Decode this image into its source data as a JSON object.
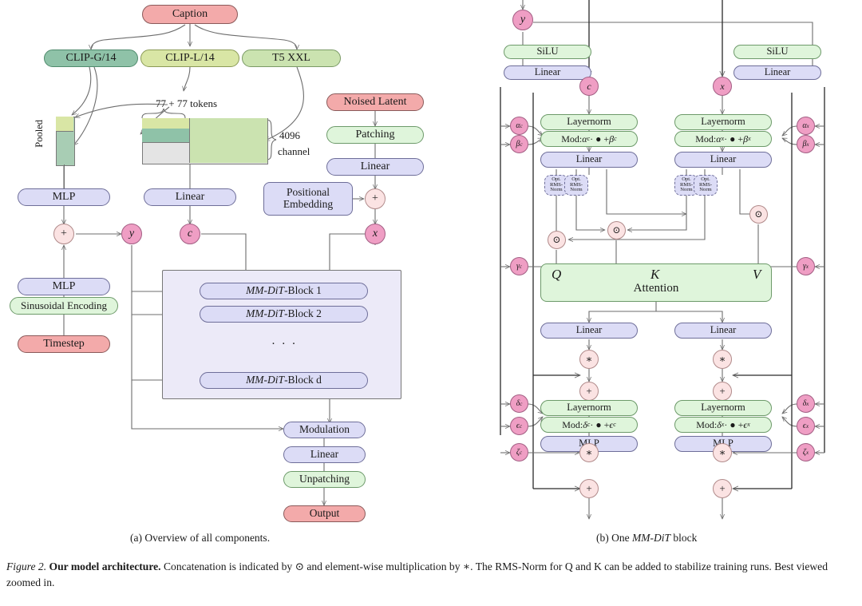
{
  "figure": {
    "number_label": "Figure 2.",
    "bold_title": "Our model architecture.",
    "caption_rest": " Concatenation is indicated by ⊙ and element-wise multiplication by ∗. The RMS-Norm for Q and K can be added to stabilize training runs. Best viewed zoomed in.",
    "subcaption_a": "(a) Overview of all components.",
    "subcaption_b_pre": "(b) One ",
    "subcaption_b_it": "MM-DiT",
    "subcaption_b_post": " block"
  },
  "colors": {
    "red": "#f3aaaa",
    "blue": "#dcdcf6",
    "green_light": "#dff5db",
    "green_mid": "#c9e3c2",
    "green_dark": "#8fc2a8",
    "green_yellow": "#d9e6a5",
    "pink_circle": "#ef9ec4",
    "op_circle": "#fbe3e3",
    "group_fill": "#eceaf8",
    "gray_block": "#e4e4e4"
  },
  "panel_a": {
    "caption_box": "Caption",
    "encoders": [
      {
        "label": "CLIP-G/14"
      },
      {
        "label": "CLIP-L/14"
      },
      {
        "label": "T5 XXL"
      }
    ],
    "annotations": {
      "tokens": "77 + 77 tokens",
      "channel_line1": "4096",
      "channel_line2": "channel",
      "pooled": "Pooled"
    },
    "left_chain": [
      {
        "label": "MLP",
        "style": "blue"
      },
      {
        "label": "MLP",
        "style": "blue"
      },
      {
        "label": "Sinusoidal Encoding",
        "style": "green"
      },
      {
        "label": "Timestep",
        "style": "red"
      }
    ],
    "middle_chain": [
      {
        "label": "Linear",
        "style": "blue"
      }
    ],
    "right_chain": [
      {
        "label": "Noised Latent",
        "style": "red"
      },
      {
        "label": "Patching",
        "style": "green"
      },
      {
        "label": "Linear",
        "style": "blue"
      }
    ],
    "positional_embedding": "Positional\nEmbedding",
    "positional_embedding_l1": "Positional",
    "positional_embedding_l2": "Embedding",
    "variables": {
      "y": "y",
      "c": "c",
      "x": "x",
      "plus": "+"
    },
    "blocks": [
      {
        "prefix": "MM-DiT",
        "suffix": "-Block 1"
      },
      {
        "prefix": "MM-DiT",
        "suffix": "-Block 2"
      },
      {
        "prefix": "MM-DiT",
        "suffix": "-Block d"
      }
    ],
    "blocks_ellipsis": "· · ·",
    "tail_chain": [
      {
        "label": "Modulation",
        "style": "blue"
      },
      {
        "label": "Linear",
        "style": "blue"
      },
      {
        "label": "Unpatching",
        "style": "green"
      },
      {
        "label": "Output",
        "style": "red"
      }
    ]
  },
  "panel_b": {
    "inputs": {
      "y": "y",
      "c": "c",
      "x": "x"
    },
    "mod_paths": [
      {
        "side": "c",
        "silu": "SiLU",
        "linear": "Linear"
      },
      {
        "side": "x",
        "silu": "SiLU",
        "linear": "Linear"
      }
    ],
    "branch_c": {
      "layernorm1": "Layernorm",
      "mod1": "Mod: αc · ● + βc",
      "mod1_parts": {
        "pre": "Mod: ",
        "a": "α",
        "asub": "c",
        "mid": " · ● + ",
        "b": "β",
        "bsub": "c"
      },
      "linear1": "Linear",
      "rmsnorm_q": "Opt. RMS-Norm",
      "rmsnorm_k": "Opt. RMS-Norm",
      "linear2": "Linear",
      "layernorm2": "Layernorm",
      "mod2_parts": {
        "pre": "Mod: ",
        "a": "δ",
        "asub": "c",
        "mid": " · ● + ",
        "b": "ϵ",
        "bsub": "c"
      },
      "mlp": "MLP"
    },
    "branch_x": {
      "layernorm1": "Layernorm",
      "mod1_parts": {
        "pre": "Mod: ",
        "a": "α",
        "asub": "x",
        "mid": " · ● + ",
        "b": "β",
        "bsub": "x"
      },
      "linear1": "Linear",
      "rmsnorm_q": "Opt. RMS-Norm",
      "rmsnorm_k": "Opt. RMS-Norm",
      "linear2": "Linear",
      "layernorm2": "Layernorm",
      "mod2_parts": {
        "pre": "Mod: ",
        "a": "δ",
        "asub": "x",
        "mid": " · ● + ",
        "b": "ϵ",
        "bsub": "x"
      },
      "mlp": "MLP"
    },
    "rms_norm_lines": [
      "Opt.",
      "RMS-",
      "Norm"
    ],
    "attention": {
      "label": "Attention",
      "q": "Q",
      "k": "K",
      "v": "V"
    },
    "params_left": [
      {
        "sym": "α",
        "sub": "c"
      },
      {
        "sym": "β",
        "sub": "c"
      },
      {
        "sym": "γ",
        "sub": "c"
      },
      {
        "sym": "δ",
        "sub": "c"
      },
      {
        "sym": "ϵ",
        "sub": "c"
      },
      {
        "sym": "ζ",
        "sub": "c"
      }
    ],
    "params_right": [
      {
        "sym": "α",
        "sub": "x"
      },
      {
        "sym": "β",
        "sub": "x"
      },
      {
        "sym": "γ",
        "sub": "x"
      },
      {
        "sym": "δ",
        "sub": "x"
      },
      {
        "sym": "ϵ",
        "sub": "x"
      },
      {
        "sym": "ζ",
        "sub": "x"
      }
    ],
    "ops": {
      "concat": "⊙",
      "mult": "∗",
      "add": "+"
    }
  }
}
